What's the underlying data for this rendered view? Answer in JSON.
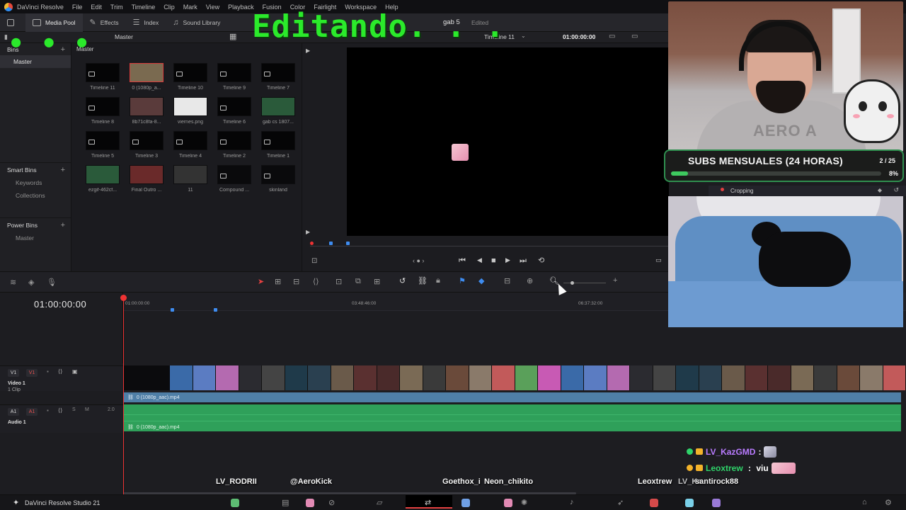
{
  "menubar": {
    "app_name": "DaVinci Resolve",
    "items": [
      "File",
      "Edit",
      "Trim",
      "Timeline",
      "Clip",
      "Mark",
      "View",
      "Playback",
      "Fusion",
      "Color",
      "Fairlight",
      "Workspace",
      "Help"
    ]
  },
  "toolbar": {
    "media_pool": "Media Pool",
    "effects": "Effects",
    "index": "Index",
    "sound_library": "Sound Library",
    "project_name": "gab 5",
    "project_status": "Edited"
  },
  "subbar": {
    "pool_breadcrumb": "Master",
    "timeline_name": "Timeline 11",
    "timecode": "01:00:00:00"
  },
  "bins": {
    "header": "Bins",
    "master": "Master",
    "smart_bins": "Smart Bins",
    "smart_items": [
      "Keywords",
      "Collections"
    ],
    "power_bins": "Power Bins",
    "power_items": [
      "Master"
    ]
  },
  "pool": {
    "title": "Master",
    "clips": [
      {
        "name": "Timeline 11",
        "kind": "timeline"
      },
      {
        "name": "0 (1080p_a...",
        "kind": "video",
        "selected": true
      },
      {
        "name": "Timeline 10",
        "kind": "timeline"
      },
      {
        "name": "Timeline 9",
        "kind": "timeline"
      },
      {
        "name": "Timeline 7",
        "kind": "timeline"
      },
      {
        "name": "Timeline 8",
        "kind": "timeline"
      },
      {
        "name": "8b71c8fa-8...",
        "kind": "video"
      },
      {
        "name": "viernes.png",
        "kind": "image"
      },
      {
        "name": "Timeline 6",
        "kind": "timeline"
      },
      {
        "name": "gab cs 1807...",
        "kind": "video"
      },
      {
        "name": "Timeline 5",
        "kind": "timeline"
      },
      {
        "name": "Timeline 3",
        "kind": "timeline"
      },
      {
        "name": "Timeline 4",
        "kind": "timeline"
      },
      {
        "name": "Timeline 2",
        "kind": "timeline"
      },
      {
        "name": "Timeline 1",
        "kind": "timeline"
      },
      {
        "name": "ezgif-462cf...",
        "kind": "video"
      },
      {
        "name": "Final Outro ...",
        "kind": "video"
      },
      {
        "name": "11",
        "kind": "video"
      },
      {
        "name": "Compound ...",
        "kind": "compound"
      },
      {
        "name": "skinland",
        "kind": "compound"
      }
    ]
  },
  "timeline": {
    "timecode": "01:00:00:00",
    "ruler_labels": [
      "01:00:00:00",
      "03:48:46:00",
      "06:37:32:00"
    ],
    "video_track": {
      "badge_a": "V1",
      "badge_b": "V1",
      "name": "Video 1",
      "count": "1 Clip",
      "clip_label": "0 (1080p_aac).mp4"
    },
    "audio_track": {
      "badge_a": "A1",
      "badge_b": "A1",
      "solo": "S",
      "mute": "M",
      "level": "2.0",
      "name": "Audio 1",
      "clip_label": "0 (1080p_aac).mp4"
    }
  },
  "overlay": {
    "title": "Editando. . .",
    "dots": "● ● ●"
  },
  "webcam": {
    "shirt_text": "AERO A"
  },
  "subs_goal": {
    "title": "SUBS MENSUALES (24 HORAS)",
    "count": "2 / 25",
    "percent_label": "8%",
    "progress": 0.08
  },
  "inspector": {
    "cropping_label": "Cropping"
  },
  "chat": [
    {
      "user": "LV_KazGMD",
      "sep": " :",
      "message": "",
      "user_color": "#b97bff"
    },
    {
      "user": "Leoxtrew",
      "sep": " : ",
      "message": "viu",
      "user_color": "#2fd36a"
    }
  ],
  "name_tags": [
    "LV_RODRII",
    "@AeroKick",
    "Goethox_i",
    "Neon_chikito",
    "Leoxtrew",
    "LV_Ka",
    "santirock88"
  ],
  "statusbar": {
    "product": "DaVinci Resolve Studio 21"
  },
  "colors": {
    "accent_green": "#2bea2b",
    "playhead": "#e33333",
    "video_clip": "#4f7fa7",
    "audio_clip": "#2fa05a"
  }
}
